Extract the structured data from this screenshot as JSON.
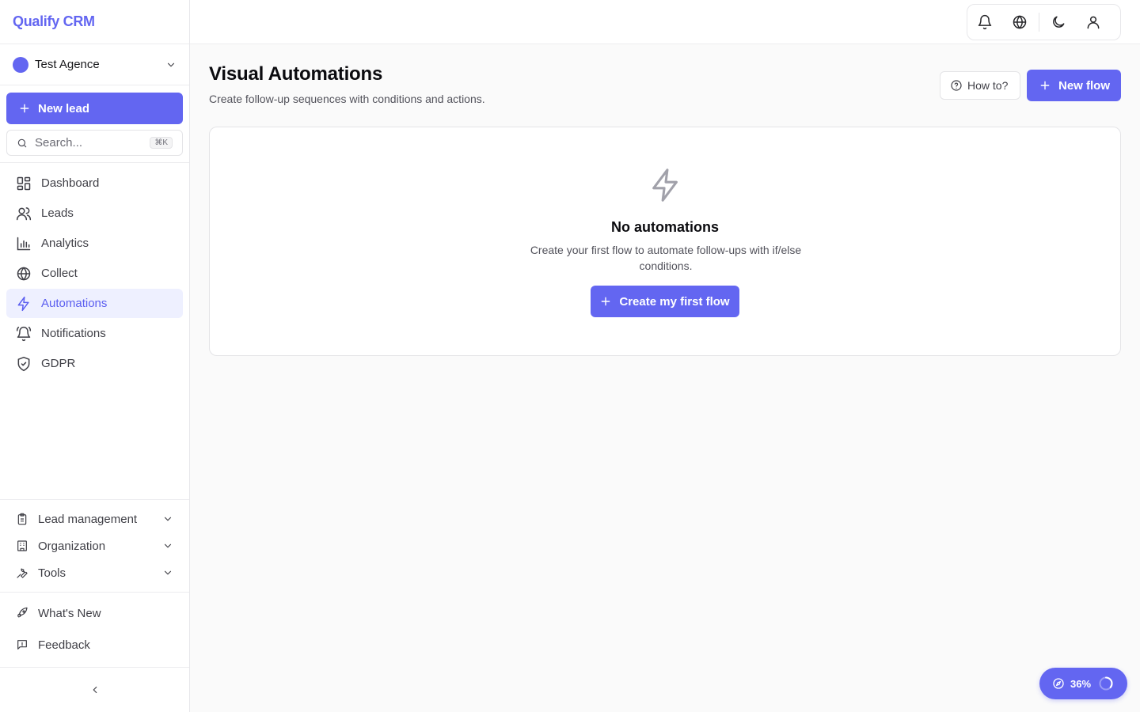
{
  "app": {
    "name": "Qualify CRM",
    "brand_color": "#6366f1"
  },
  "org": {
    "name": "Test Agence"
  },
  "sidebar": {
    "new_lead_label": "New lead",
    "search_placeholder": "Search...",
    "search_shortcut": "⌘K",
    "items": [
      {
        "label": "Dashboard",
        "icon": "layout-grid-icon"
      },
      {
        "label": "Leads",
        "icon": "users-icon"
      },
      {
        "label": "Analytics",
        "icon": "bar-chart-icon"
      },
      {
        "label": "Collect",
        "icon": "globe-icon"
      },
      {
        "label": "Automations",
        "icon": "zap-icon",
        "active": true
      },
      {
        "label": "Notifications",
        "icon": "bell-ring-icon"
      },
      {
        "label": "GDPR",
        "icon": "shield-check-icon"
      }
    ],
    "groups": [
      {
        "label": "Lead management",
        "icon": "clipboard-icon"
      },
      {
        "label": "Organization",
        "icon": "building-icon"
      },
      {
        "label": "Tools",
        "icon": "wrench-icon"
      }
    ],
    "extras": [
      {
        "label": "What's New",
        "icon": "rocket-icon"
      },
      {
        "label": "Feedback",
        "icon": "message-square-icon"
      }
    ]
  },
  "main": {
    "title": "Visual Automations",
    "subtitle": "Create follow-up sequences with conditions and actions.",
    "how_to_label": "How to?",
    "new_flow_label": "New flow",
    "empty_state": {
      "title": "No automations",
      "description": "Create your first flow to automate follow-ups with if/else conditions.",
      "button_label": "Create my first flow"
    }
  },
  "progress": {
    "label": "36%",
    "value": 0.36
  }
}
